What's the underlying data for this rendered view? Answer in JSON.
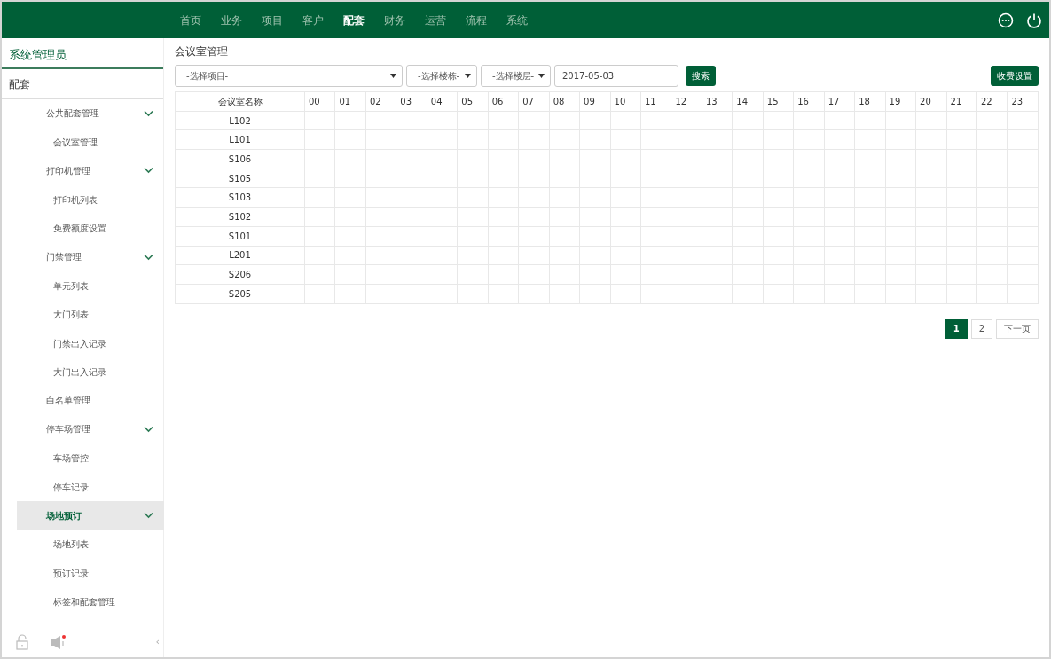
{
  "topnav": [
    {
      "label": "首页",
      "selected": false
    },
    {
      "label": "业务",
      "selected": false
    },
    {
      "label": "项目",
      "selected": false
    },
    {
      "label": "客户",
      "selected": false
    },
    {
      "label": "配套",
      "selected": true
    },
    {
      "label": "财务",
      "selected": false
    },
    {
      "label": "运营",
      "selected": false
    },
    {
      "label": "流程",
      "selected": false
    },
    {
      "label": "系统",
      "selected": false
    }
  ],
  "sidebar": {
    "user": "系统管理员",
    "section": "配套",
    "items": [
      {
        "label": "公共配套管理",
        "expanded": true,
        "selected": false,
        "children": [
          {
            "label": "会议室管理"
          }
        ]
      },
      {
        "label": "打印机管理",
        "expanded": true,
        "selected": false,
        "children": [
          {
            "label": "打印机列表"
          },
          {
            "label": "免费额度设置"
          }
        ]
      },
      {
        "label": "门禁管理",
        "expanded": true,
        "selected": false,
        "children": [
          {
            "label": "单元列表"
          },
          {
            "label": "大门列表"
          },
          {
            "label": "门禁出入记录"
          },
          {
            "label": "大门出入记录"
          }
        ]
      },
      {
        "label": "白名单管理",
        "selected": false
      },
      {
        "label": "停车场管理",
        "expanded": true,
        "selected": false,
        "children": [
          {
            "label": "车场管控"
          },
          {
            "label": "停车记录"
          }
        ]
      },
      {
        "label": "场地预订",
        "expanded": true,
        "selected": true,
        "children": [
          {
            "label": "场地列表"
          },
          {
            "label": "预订记录"
          },
          {
            "label": "标签和配套管理"
          }
        ]
      }
    ],
    "collapse": "‹"
  },
  "page_title": "会议室管理",
  "filters": {
    "project": "-选择项目-",
    "building": "-选择楼栋-",
    "floor": "-选择楼层-",
    "date": "2017-05-03",
    "search_button": "搜索",
    "fee_button": "收费设置"
  },
  "table": {
    "columns": [
      "会议室名称",
      "00",
      "01",
      "02",
      "03",
      "04",
      "05",
      "06",
      "07",
      "08",
      "09",
      "10",
      "11",
      "12",
      "13",
      "14",
      "15",
      "16",
      "17",
      "18",
      "19",
      "20",
      "21",
      "22",
      "23"
    ],
    "rows": [
      "L102",
      "L101",
      "S106",
      "S105",
      "S103",
      "S102",
      "S101",
      "L201",
      "S206",
      "S205"
    ]
  },
  "pagination": {
    "pages": [
      {
        "label": "1",
        "selected": true
      },
      {
        "label": "2",
        "selected": false
      }
    ],
    "next": "下一页"
  }
}
